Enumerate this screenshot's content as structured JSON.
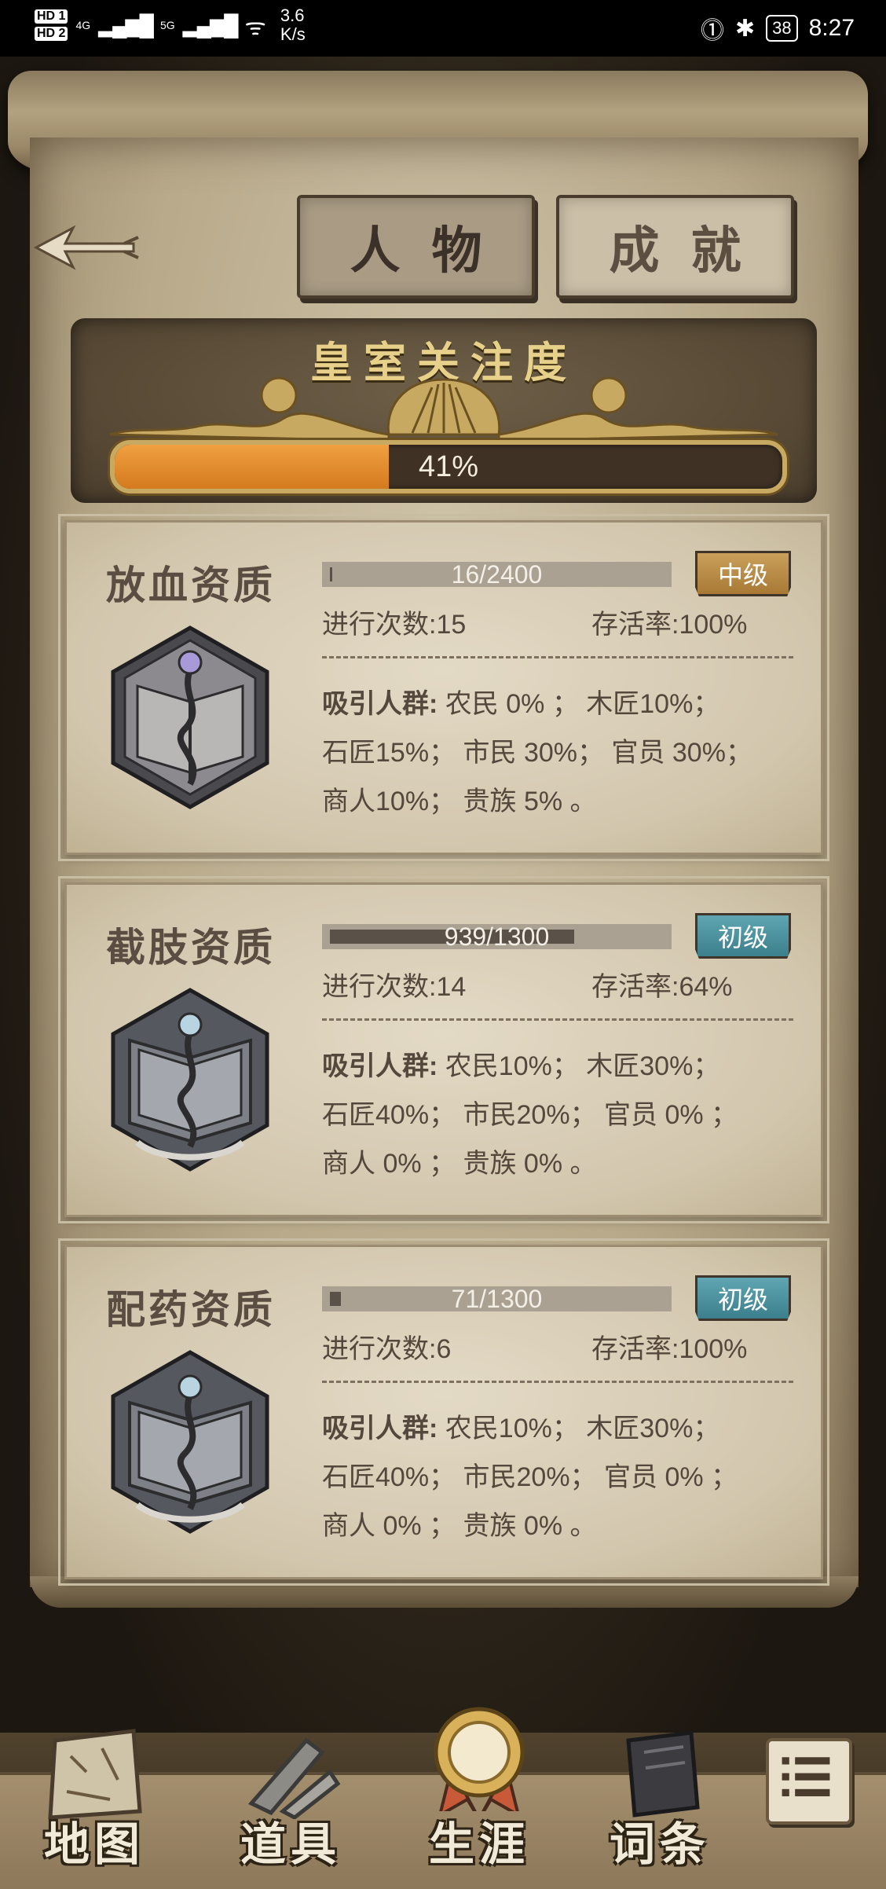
{
  "status_bar": {
    "hd1": "HD 1",
    "hd2": "HD 2",
    "net1": "4G",
    "net2": "5G",
    "speed_value": "3.6",
    "speed_unit": "K/s",
    "battery": "38",
    "time": "8:27"
  },
  "tabs": [
    {
      "label": "人物",
      "active": true
    },
    {
      "label": "成就",
      "active": false
    }
  ],
  "royal_attention": {
    "title": "皇室关注度",
    "progress_text": "41%",
    "progress_value": 0.41
  },
  "traits": [
    {
      "name": "放血资质",
      "xp_text": "16/2400",
      "xp_fraction": 0.0067,
      "level": "中级",
      "count_text": "进行次数:15",
      "rate_text": "存活率:100%",
      "attract_label": "吸引人群:",
      "attract_line1": "农民 0% ； 木匠10%；",
      "attract_line2": "石匠15%； 市民 30%； 官员 30%；",
      "attract_line3": "商人10%； 贵族 5% 。"
    },
    {
      "name": "截肢资质",
      "xp_text": "939/1300",
      "xp_fraction": 0.722,
      "level": "初级",
      "count_text": "进行次数:14",
      "rate_text": "存活率:64%",
      "attract_label": "吸引人群:",
      "attract_line1": "农民10%； 木匠30%；",
      "attract_line2": "石匠40%； 市民20%； 官员 0% ；",
      "attract_line3": "商人 0% ； 贵族 0% 。"
    },
    {
      "name": "配药资质",
      "xp_text": "71/1300",
      "xp_fraction": 0.055,
      "level": "初级",
      "count_text": "进行次数:6",
      "rate_text": "存活率:100%",
      "attract_label": "吸引人群:",
      "attract_line1": "农民10%； 木匠30%；",
      "attract_line2": "石匠40%； 市民20%； 官员 0% ；",
      "attract_line3": "商人 0% ； 贵族 0% 。"
    }
  ],
  "bottom_nav": [
    {
      "label": "地图",
      "icon": "map-icon"
    },
    {
      "label": "道具",
      "icon": "tools-icon"
    },
    {
      "label": "生涯",
      "icon": "medal-icon",
      "active": true
    },
    {
      "label": "词条",
      "icon": "book-icon"
    }
  ],
  "menu_icon": "list-icon",
  "colors": {
    "progress_orange": "#e08a2c",
    "level_mid": "#b8893f",
    "level_low": "#4d93a0",
    "ornament_gold": "#c8a961"
  }
}
